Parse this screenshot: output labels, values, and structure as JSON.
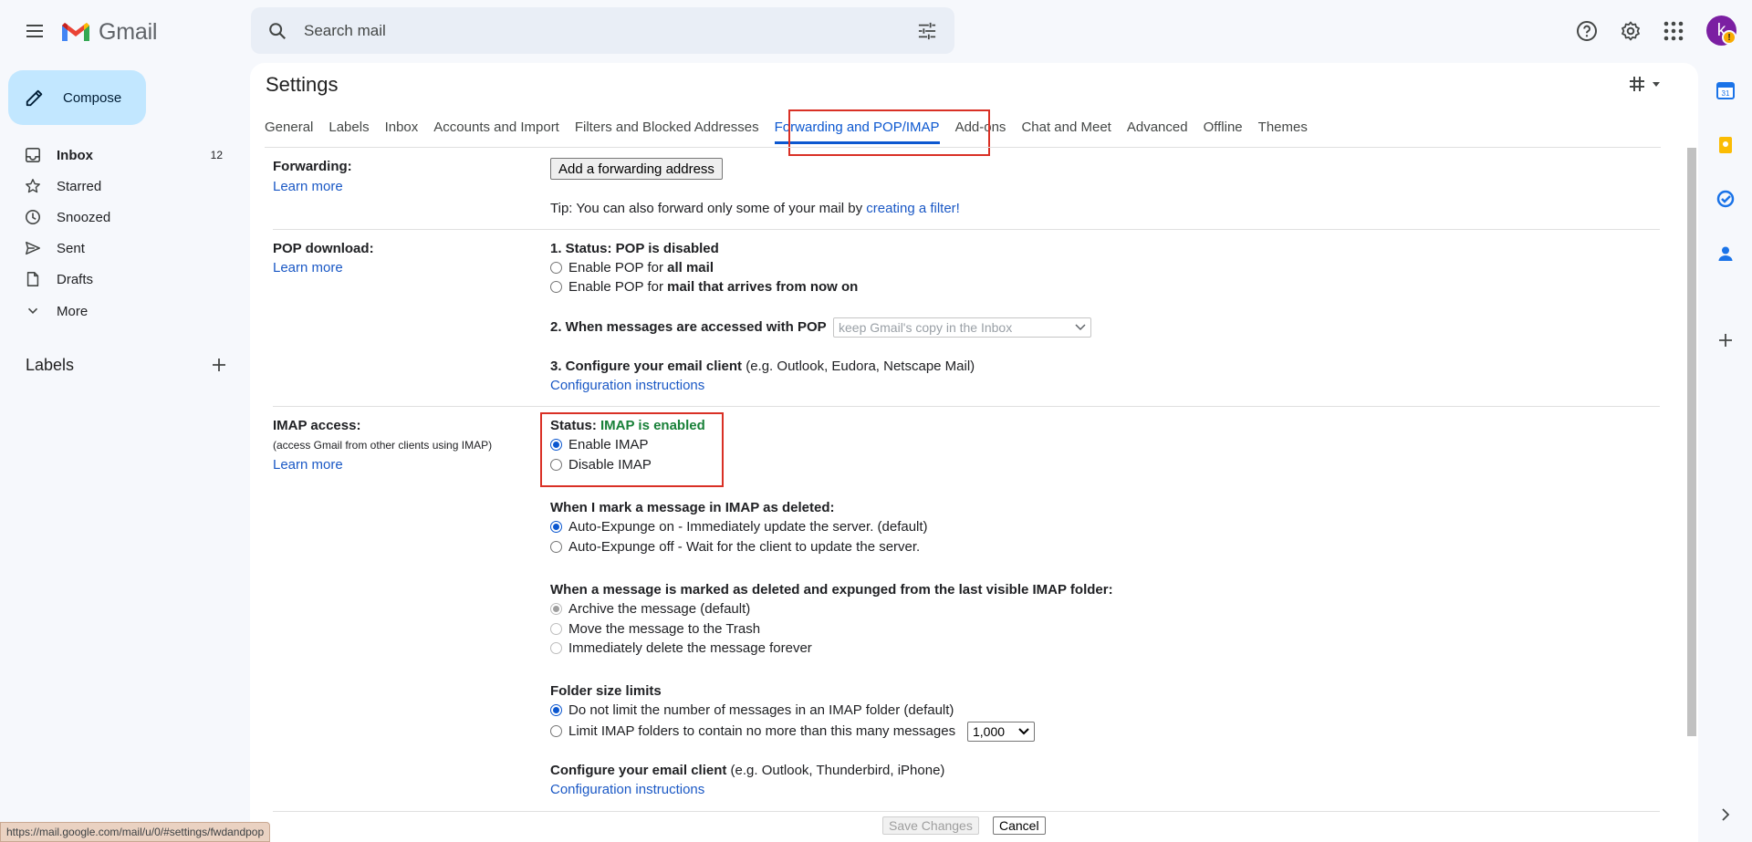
{
  "app": {
    "name": "Gmail",
    "search_placeholder": "Search mail",
    "avatar_initial": "k",
    "avatar_badge": "!"
  },
  "compose_label": "Compose",
  "nav": [
    {
      "label": "Inbox",
      "count": "12",
      "icon": "inbox-icon"
    },
    {
      "label": "Starred",
      "count": "",
      "icon": "star-icon"
    },
    {
      "label": "Snoozed",
      "count": "",
      "icon": "clock-icon"
    },
    {
      "label": "Sent",
      "count": "",
      "icon": "send-icon"
    },
    {
      "label": "Drafts",
      "count": "",
      "icon": "draft-icon"
    },
    {
      "label": "More",
      "count": "",
      "icon": "chevron-down-icon"
    }
  ],
  "labels_heading": "Labels",
  "settings": {
    "title": "Settings",
    "tabs": [
      "General",
      "Labels",
      "Inbox",
      "Accounts and Import",
      "Filters and Blocked Addresses",
      "Forwarding and POP/IMAP",
      "Add-ons",
      "Chat and Meet",
      "Advanced",
      "Offline",
      "Themes"
    ],
    "active_tab": "Forwarding and POP/IMAP"
  },
  "forwarding": {
    "label": "Forwarding:",
    "learn_more": "Learn more",
    "add_button": "Add a forwarding address",
    "tip_prefix": "Tip: You can also forward only some of your mail by ",
    "tip_link": "creating a filter!"
  },
  "pop": {
    "label": "POP download:",
    "learn_more": "Learn more",
    "status": "1. Status: POP is disabled",
    "opt1_prefix": "Enable POP for ",
    "opt1_bold": "all mail",
    "opt2_prefix": "Enable POP for ",
    "opt2_bold": "mail that arrives from now on",
    "q2": "2. When messages are accessed with POP",
    "q2_select": "keep Gmail's copy in the Inbox",
    "q3_bold": "3. Configure your email client",
    "q3_rest": " (e.g. Outlook, Eudora, Netscape Mail)",
    "config_link": "Configuration instructions"
  },
  "imap": {
    "label": "IMAP access:",
    "sub": "(access Gmail from other clients using IMAP)",
    "learn_more": "Learn more",
    "status_prefix": "Status: ",
    "status_value": "IMAP is enabled",
    "status_color": "#188038",
    "enable": "Enable IMAP",
    "disable": "Disable IMAP",
    "deleted_heading": "When I mark a message in IMAP as deleted:",
    "expunge_on": "Auto-Expunge on - Immediately update the server. (default)",
    "expunge_off": "Auto-Expunge off - Wait for the client to update the server.",
    "expunged_heading": "When a message is marked as deleted and expunged from the last visible IMAP folder:",
    "archive": "Archive the message (default)",
    "trash": "Move the message to the Trash",
    "delete_forever": "Immediately delete the message forever",
    "folder_heading": "Folder size limits",
    "no_limit": "Do not limit the number of messages in an IMAP folder (default)",
    "limit": "Limit IMAP folders to contain no more than this many messages",
    "limit_select": "1,000",
    "client_bold": "Configure your email client",
    "client_rest": " (e.g. Outlook, Thunderbird, iPhone)",
    "config_link": "Configuration instructions"
  },
  "footer": {
    "save": "Save Changes",
    "cancel": "Cancel"
  },
  "status_url": "https://mail.google.com/mail/u/0/#settings/fwdandpop",
  "colors": {
    "accent": "#0b57d0",
    "highlight": "#d93025",
    "compose_bg": "#c2e7ff"
  }
}
